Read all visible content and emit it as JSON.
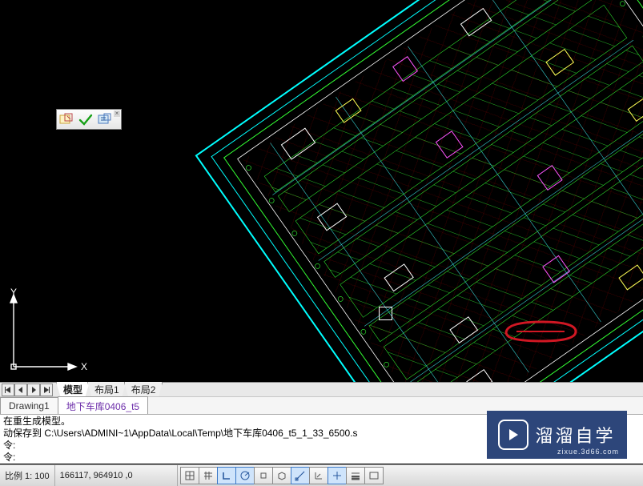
{
  "ucs": {
    "x_label": "X",
    "y_label": "Y"
  },
  "tabs": {
    "model_layout": [
      {
        "label": "模型",
        "active": true
      },
      {
        "label": "布局1",
        "active": false
      },
      {
        "label": "布局2",
        "active": false
      }
    ],
    "documents": [
      {
        "label": "Drawing1",
        "active": false
      },
      {
        "label": "地下车库0406_t5",
        "active": true
      }
    ]
  },
  "command_lines": {
    "l1": "在重生成模型。",
    "l2": "动保存到 C:\\Users\\ADMINI~1\\AppData\\Local\\Temp\\地下车库0406_t5_1_33_6500.s",
    "l3": "令:",
    "l4": "令:"
  },
  "status": {
    "scale": "比例 1: 100",
    "coords": "166117, 964910  ,0"
  },
  "watermark": {
    "title": "溜溜自学",
    "domain": "zixue.3d66.com"
  }
}
